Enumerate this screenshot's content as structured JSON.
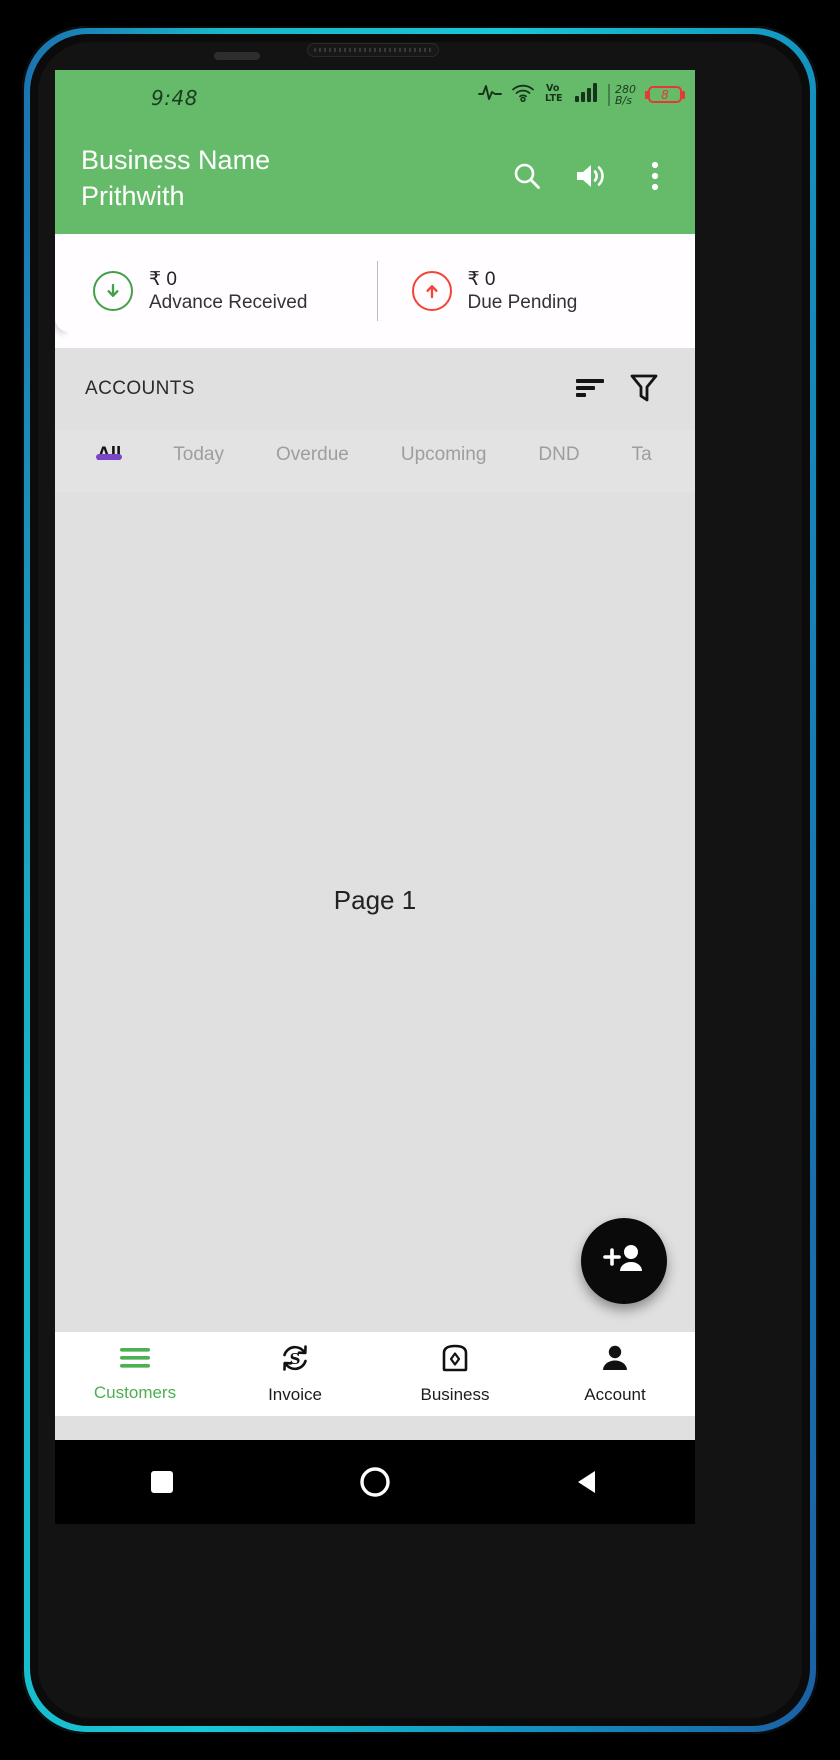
{
  "status_bar": {
    "clock": "9:48",
    "icons": [
      "pulse-icon",
      "wifi-icon",
      "volte-icon",
      "signal-bars-icon"
    ],
    "volte_top": "Vo",
    "volte_bottom": "LTE",
    "net_speed_value": "280",
    "net_speed_unit": "B/s",
    "battery_level": "8"
  },
  "app_bar": {
    "title_line1": "Business Name",
    "title_line2": "Prithwith",
    "actions": [
      {
        "name": "search-icon",
        "label": "Search"
      },
      {
        "name": "volume-icon",
        "label": "Sound"
      },
      {
        "name": "overflow-menu-icon",
        "label": "More options"
      }
    ]
  },
  "summary": {
    "advance": {
      "amount": "₹ 0",
      "label": "Advance Received",
      "color": "#43a047",
      "direction": "down"
    },
    "due": {
      "amount": "₹ 0",
      "label": "Due Pending",
      "color": "#f44336",
      "direction": "up"
    }
  },
  "accounts": {
    "title": "ACCOUNTS",
    "sort_label": "Sort",
    "filter_label": "Filter"
  },
  "tabs": {
    "items": [
      {
        "label": "All",
        "active": true
      },
      {
        "label": "Today",
        "active": false
      },
      {
        "label": "Overdue",
        "active": false
      },
      {
        "label": "Upcoming",
        "active": false
      },
      {
        "label": "DND",
        "active": false
      },
      {
        "label": "Ta",
        "active": false
      }
    ],
    "indicator_color": "#7b46c6"
  },
  "content": {
    "page_label": "Page 1"
  },
  "fab": {
    "name": "add-person-icon",
    "label": "Add customer"
  },
  "bottom_nav": {
    "items": [
      {
        "label": "Customers",
        "icon": "menu-lines-icon",
        "active": true
      },
      {
        "label": "Invoice",
        "icon": "invoice-refresh-icon",
        "active": false
      },
      {
        "label": "Business",
        "icon": "briefcase-icon",
        "active": false
      },
      {
        "label": "Account",
        "icon": "person-icon",
        "active": false
      }
    ],
    "active_color": "#4caf50"
  },
  "system_nav": {
    "buttons": [
      {
        "name": "recents-square-button"
      },
      {
        "name": "home-circle-button"
      },
      {
        "name": "back-triangle-button"
      }
    ]
  },
  "colors": {
    "app_bar_green": "#66bb6a",
    "page_background": "#e0e0e0",
    "card_background": "#ffffff"
  }
}
